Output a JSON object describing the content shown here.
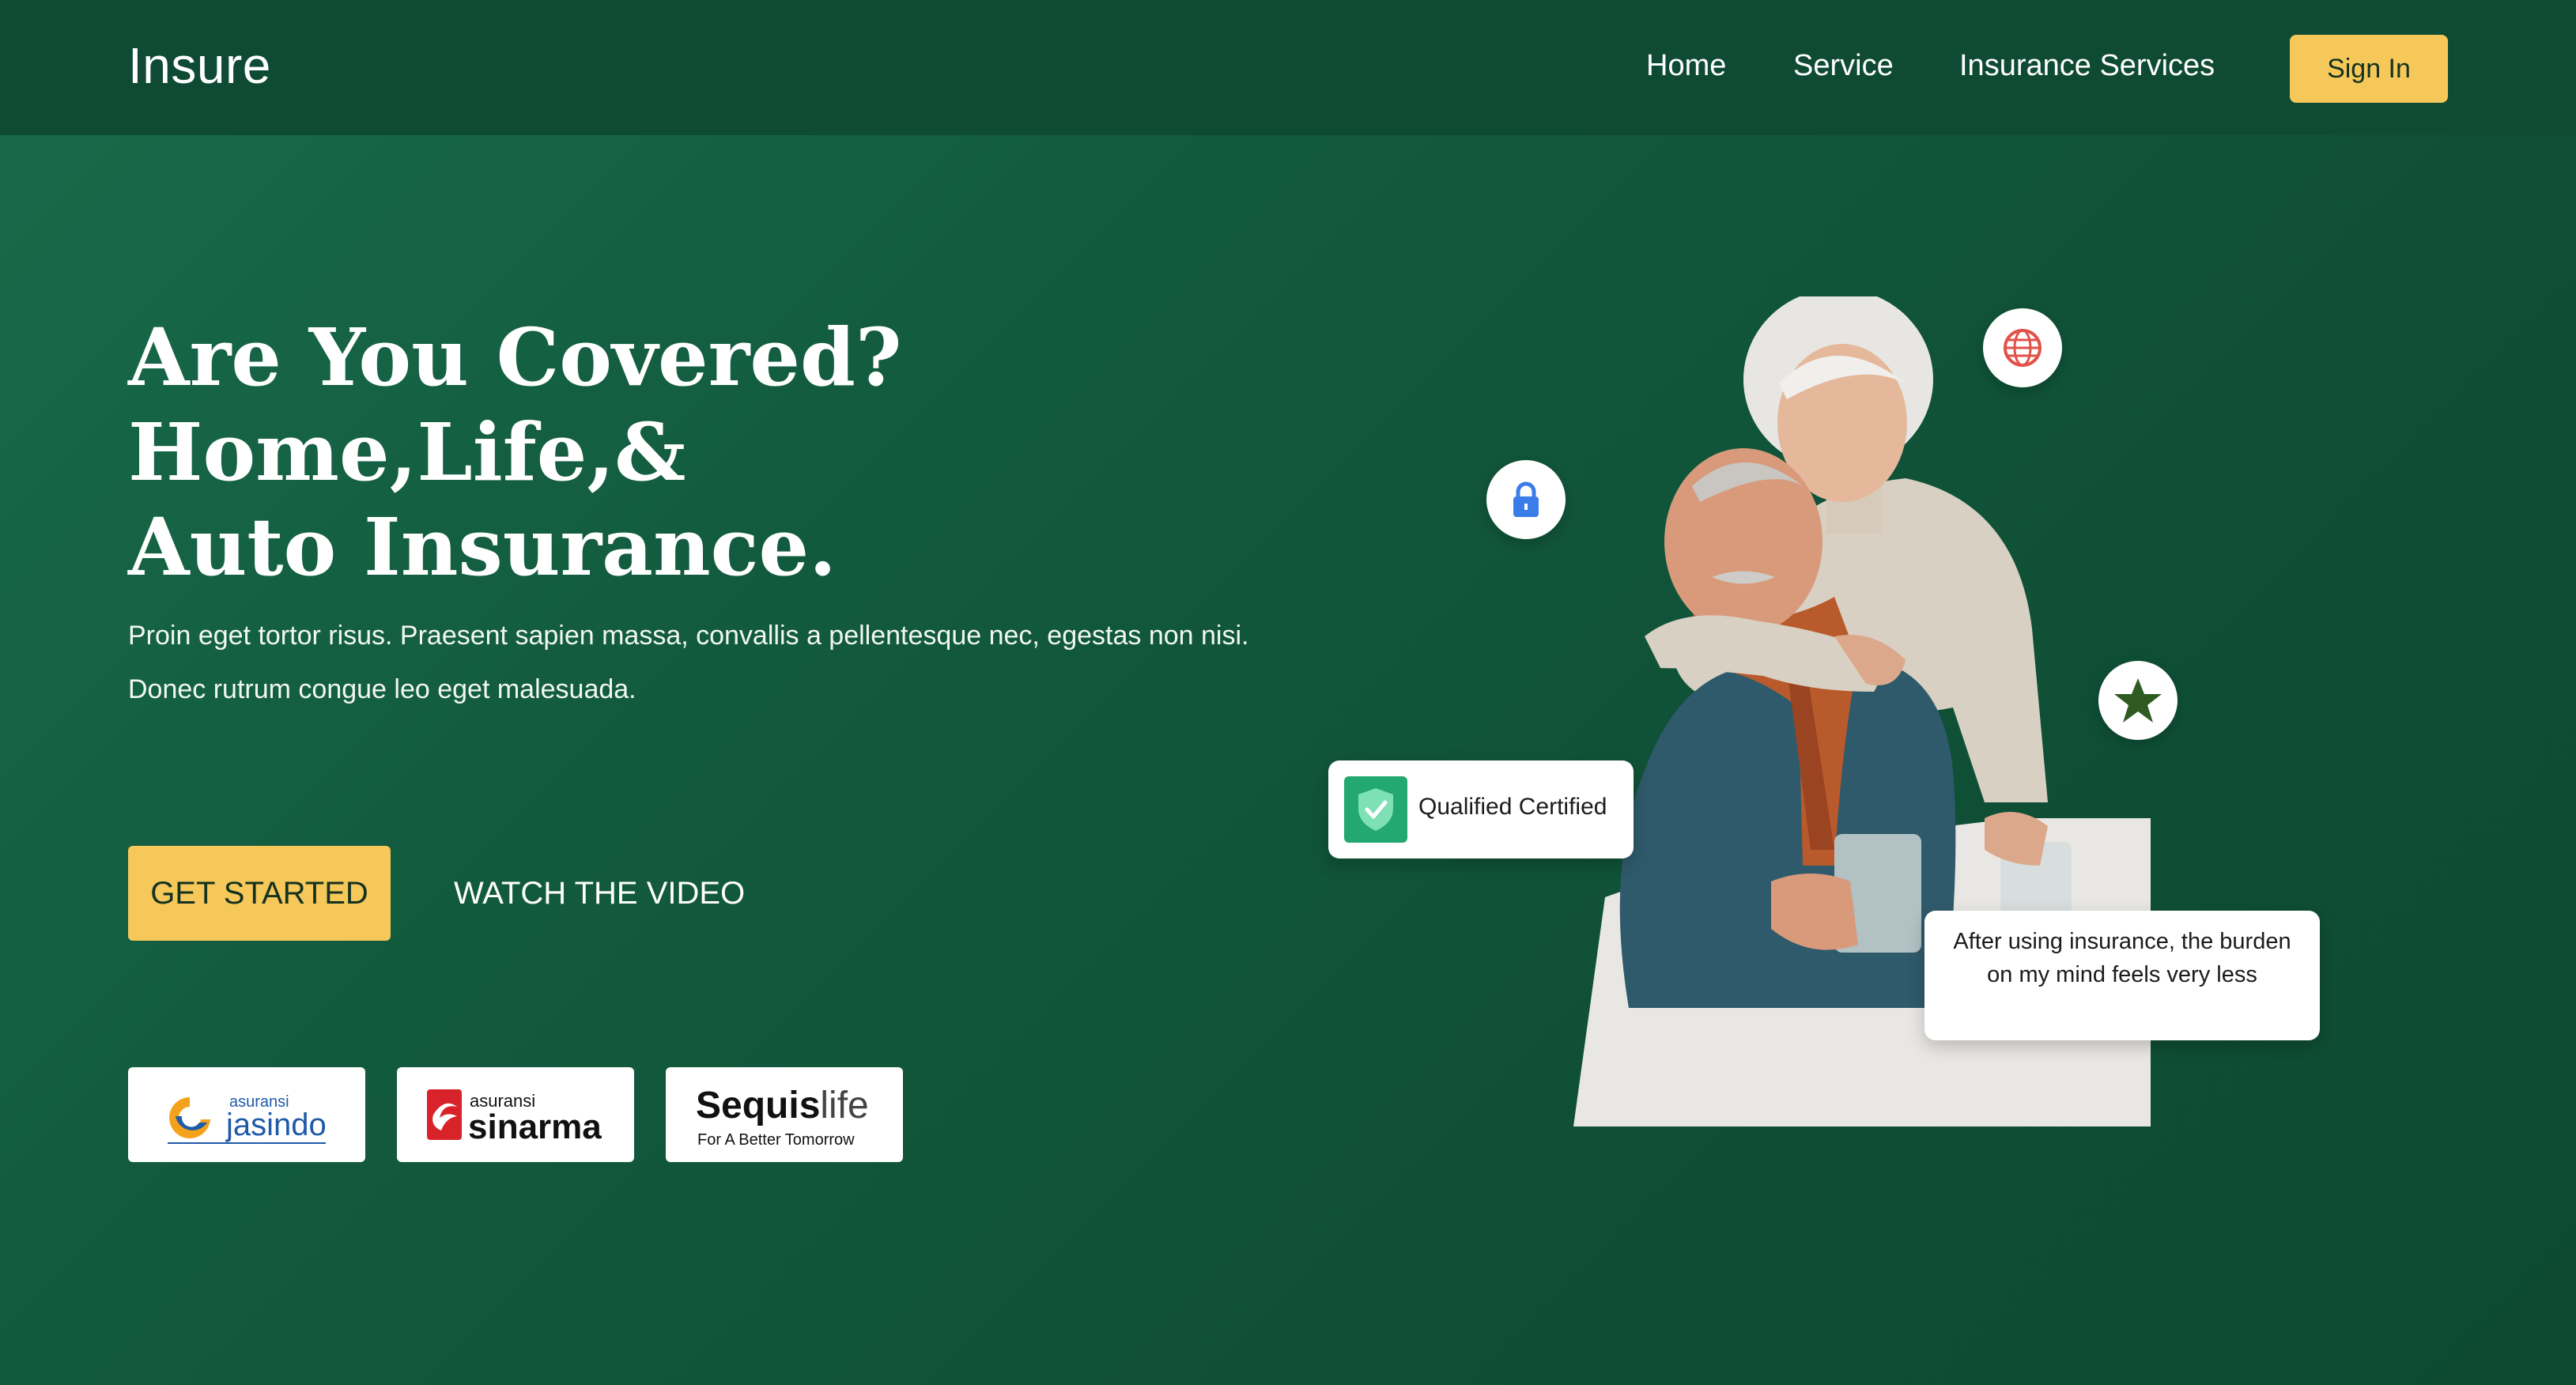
{
  "navbar": {
    "logo": "Insure",
    "links": [
      "Home",
      "Service",
      "Insurance Services"
    ],
    "signin_label": "Sign In"
  },
  "hero": {
    "title_lines": [
      "Are You Covered?",
      "Home,Life,&",
      "Auto Insurance."
    ],
    "description": "Proin eget tortor risus. Praesent sapien massa, convallis a pellentesque nec, egestas non nisi. Donec rutrum congue leo eget malesuada.",
    "primary_button": "GET STARTED",
    "secondary_button": "WATCH THE VIDEO"
  },
  "partners": [
    {
      "small": "asuransi",
      "name": "jasindo"
    },
    {
      "small": "asuransi",
      "name": "sinarma"
    },
    {
      "name_bold": "Sequis",
      "name_light": "life",
      "tagline": "For A Better Tomorrow"
    }
  ],
  "badges": {
    "certified": "Qualified Certified",
    "quote": "After using insurance, the burden on my mind feels very less"
  },
  "colors": {
    "background": "#125a3e",
    "navbar": "#0f4b34",
    "accent": "#f6c85a",
    "certified_green": "#22a870",
    "lock_blue": "#3b7de8",
    "globe_red": "#e0524a",
    "star_green": "#2f5a22"
  },
  "icons": [
    "globe-icon",
    "lock-icon",
    "star-icon",
    "shield-check-icon"
  ]
}
